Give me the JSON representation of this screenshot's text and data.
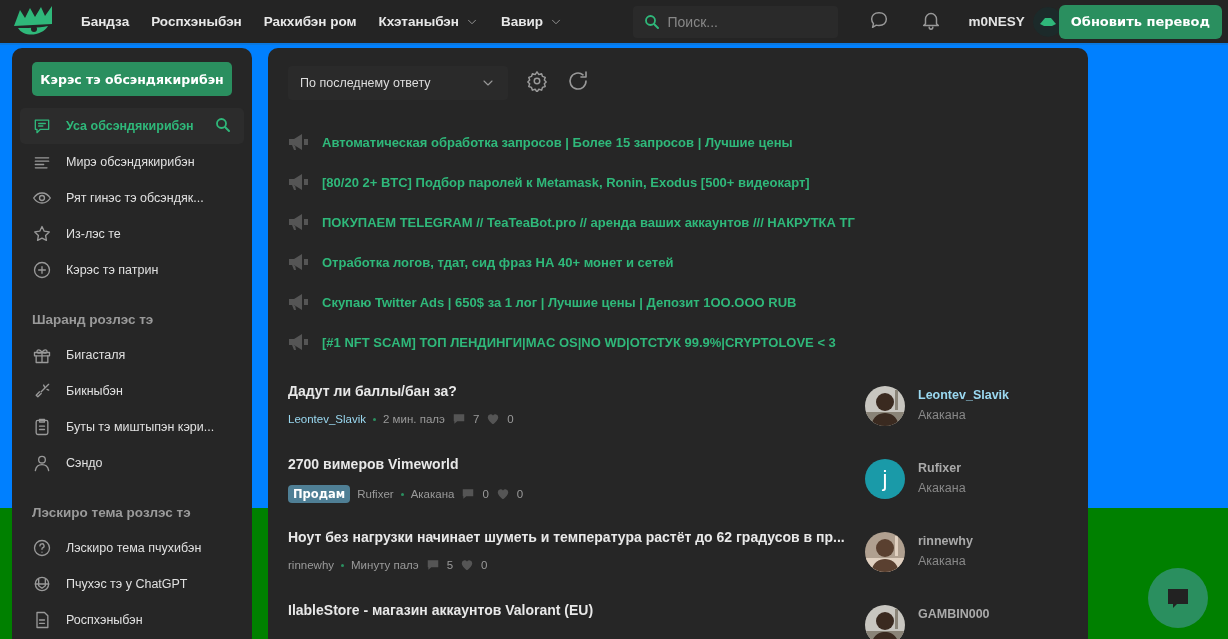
{
  "header": {
    "nav": [
      {
        "label": "Бандза",
        "dropdown": false
      },
      {
        "label": "Роспхэныбэн",
        "dropdown": false
      },
      {
        "label": "Ракхибэн ром",
        "dropdown": false
      },
      {
        "label": "Кхэтаныбэн",
        "dropdown": true
      },
      {
        "label": "Вавир",
        "dropdown": true
      }
    ],
    "search": {
      "placeholder": "Поиск..."
    },
    "username": "m0NESY",
    "update_button": "Обновить перевод"
  },
  "sidebar": {
    "primary_button": "Кэрэс тэ обсэндякирибэн",
    "items": [
      {
        "label": "Уса обсэндякирибэн",
        "selected": true
      },
      {
        "label": "Мирэ обсэндякирибэн",
        "selected": false
      },
      {
        "label": "Рят гинэс тэ обсэндяк...",
        "selected": false
      },
      {
        "label": "Из-лэс те",
        "selected": false
      },
      {
        "label": "Кэрэс тэ патрин",
        "selected": false
      }
    ],
    "sections": [
      {
        "title": "Шаранд розлэс тэ",
        "items": [
          {
            "label": "Бигасталя"
          },
          {
            "label": "Бикныбэн"
          },
          {
            "label": "Буты тэ миштыпэн кэри..."
          },
          {
            "label": "Сэндо"
          }
        ]
      },
      {
        "title": "Лэскиро тема розлэс тэ",
        "items": [
          {
            "label": "Лэскиро тема пчухибэн"
          },
          {
            "label": "Пчухэс тэ у ChatGPT"
          },
          {
            "label": "Роспхэныбэн"
          }
        ]
      }
    ]
  },
  "toolbar": {
    "sort": "По последнему ответу"
  },
  "announcements": [
    "Автоматическая обработка запросов | Более 15 запросов | Лучшие цены",
    "[80/20 2+ BTC] Подбор паролей к Metamask, Ronin, Exodus [500+ видеокарт]",
    "ПОКУПАЕМ TELEGRAM // TeaTeaBot.pro // аренда ваших аккаунтов /// НАКРУТКА ТГ",
    "Отработка логов, тдат, сид фраз НА 40+ монет и сетей",
    "Скупаю Twitter Ads | 650$ за 1 лог | Лучшие цены | Депозит 1OO.OOO RUB",
    "[#1 NFT SCAM] ТОП ЛЕНДИНГИ|MAC OS|NO WD|ОТСТУК 99.9%|CRYPTOLOVE < 3"
  ],
  "threads": [
    {
      "title": "Дадут ли баллы/бан за?",
      "author": "Leontev_Slavik",
      "highlighted": true,
      "time": "2 мин. палэ",
      "replies": "7",
      "likes": "0",
      "last_poster": "Leontev_Slavik",
      "last_time": "Акакана"
    },
    {
      "title": "2700 вимеров Vimeworld",
      "tag": "Продам",
      "author": "Rufixer",
      "highlighted": false,
      "time": "Акакана",
      "replies": "0",
      "likes": "0",
      "last_poster": "Rufixer",
      "last_time": "Акакана",
      "avatar": {
        "kind": "letter",
        "letter": "j",
        "color": "#1a9aa8"
      }
    },
    {
      "title": "Ноут без нагрузки начинает шуметь и температура растёт до 62 градусов в пр...",
      "author": "rinnewhy",
      "highlighted": false,
      "time": "Минуту палэ",
      "replies": "5",
      "likes": "0",
      "last_poster": "rinnewhy",
      "last_time": "Акакана"
    },
    {
      "title": "IlableStore - магазин аккаунтов Valorant (EU)",
      "highlighted": false,
      "last_poster": "GAMBIN000"
    }
  ]
}
